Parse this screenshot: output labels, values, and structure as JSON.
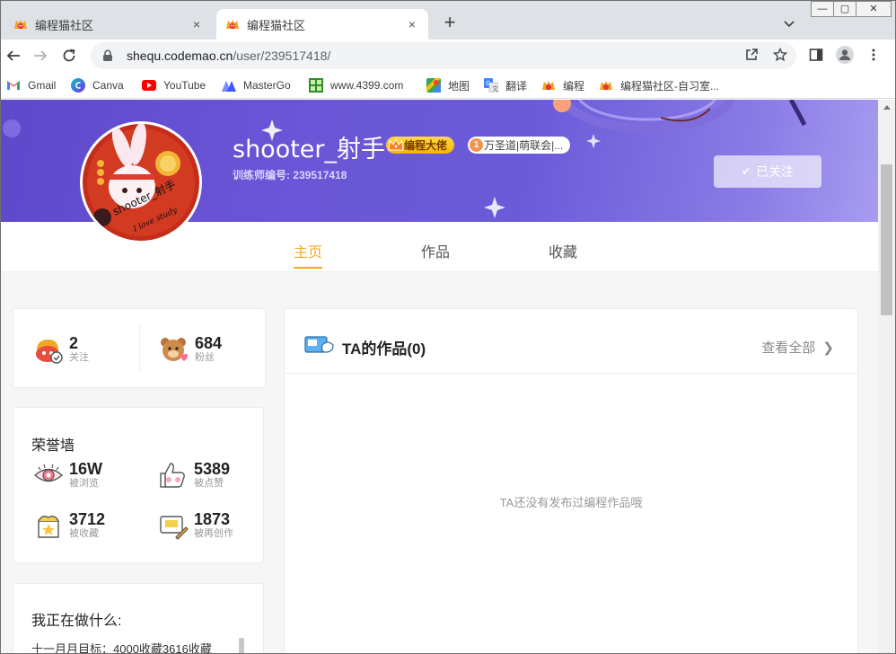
{
  "window": {
    "minimize": "—",
    "restore": "▢",
    "close": "✕"
  },
  "tabs": [
    {
      "label": "编程猫社区",
      "close": "×",
      "active": false
    },
    {
      "label": "编程猫社区",
      "close": "×",
      "active": true
    }
  ],
  "new_tab": "+",
  "address": {
    "host": "shequ.codemao.cn",
    "path": "/user/239517418/"
  },
  "bookmarks": [
    {
      "label": "Gmail",
      "icon": "gmail-icon"
    },
    {
      "label": "Canva",
      "icon": "canva-icon"
    },
    {
      "label": "YouTube",
      "icon": "youtube-icon"
    },
    {
      "label": "MasterGo",
      "icon": "mastergo-icon"
    },
    {
      "label": "www.4399.com",
      "icon": "4399-icon"
    },
    {
      "label": "地图",
      "icon": "maps-icon"
    },
    {
      "label": "翻译",
      "icon": "translate-icon"
    },
    {
      "label": "编程",
      "icon": "codemao-icon"
    },
    {
      "label": "编程猫社区-自习室...",
      "icon": "codemao-icon"
    }
  ],
  "profile": {
    "username": "shooter_射手",
    "badge_primary": "编程大佬",
    "badge_secondary": "万圣道|萌联会|...",
    "badge_secondary_num": "1",
    "trainer_id": "训练师编号: 239517418",
    "follow_label": "已关注",
    "avatar_text": "shooter_射手",
    "avatar_subtext": "I love study"
  },
  "nav": {
    "tabs": [
      "主页",
      "作品",
      "收藏"
    ],
    "active": "主页"
  },
  "follow_stats": [
    {
      "value": "2",
      "label": "关注",
      "icon": "follow-icon"
    },
    {
      "value": "684",
      "label": "粉丝",
      "icon": "fans-icon"
    }
  ],
  "honor": {
    "title": "荣誉墙",
    "stats": [
      {
        "value": "16W",
        "label": "被浏览",
        "icon": "view-icon"
      },
      {
        "value": "5389",
        "label": "被点赞",
        "icon": "like-icon"
      },
      {
        "value": "3712",
        "label": "被收藏",
        "icon": "collect-icon"
      },
      {
        "value": "1873",
        "label": "被再创作",
        "icon": "remix-icon"
      }
    ]
  },
  "doing": {
    "title": "我正在做什么:",
    "text": "十一月月目标：4000收藏3616收藏"
  },
  "works": {
    "title": "TA的作品(0)",
    "view_all": "查看全部",
    "empty": "TA还没有发布过编程作品哦"
  }
}
